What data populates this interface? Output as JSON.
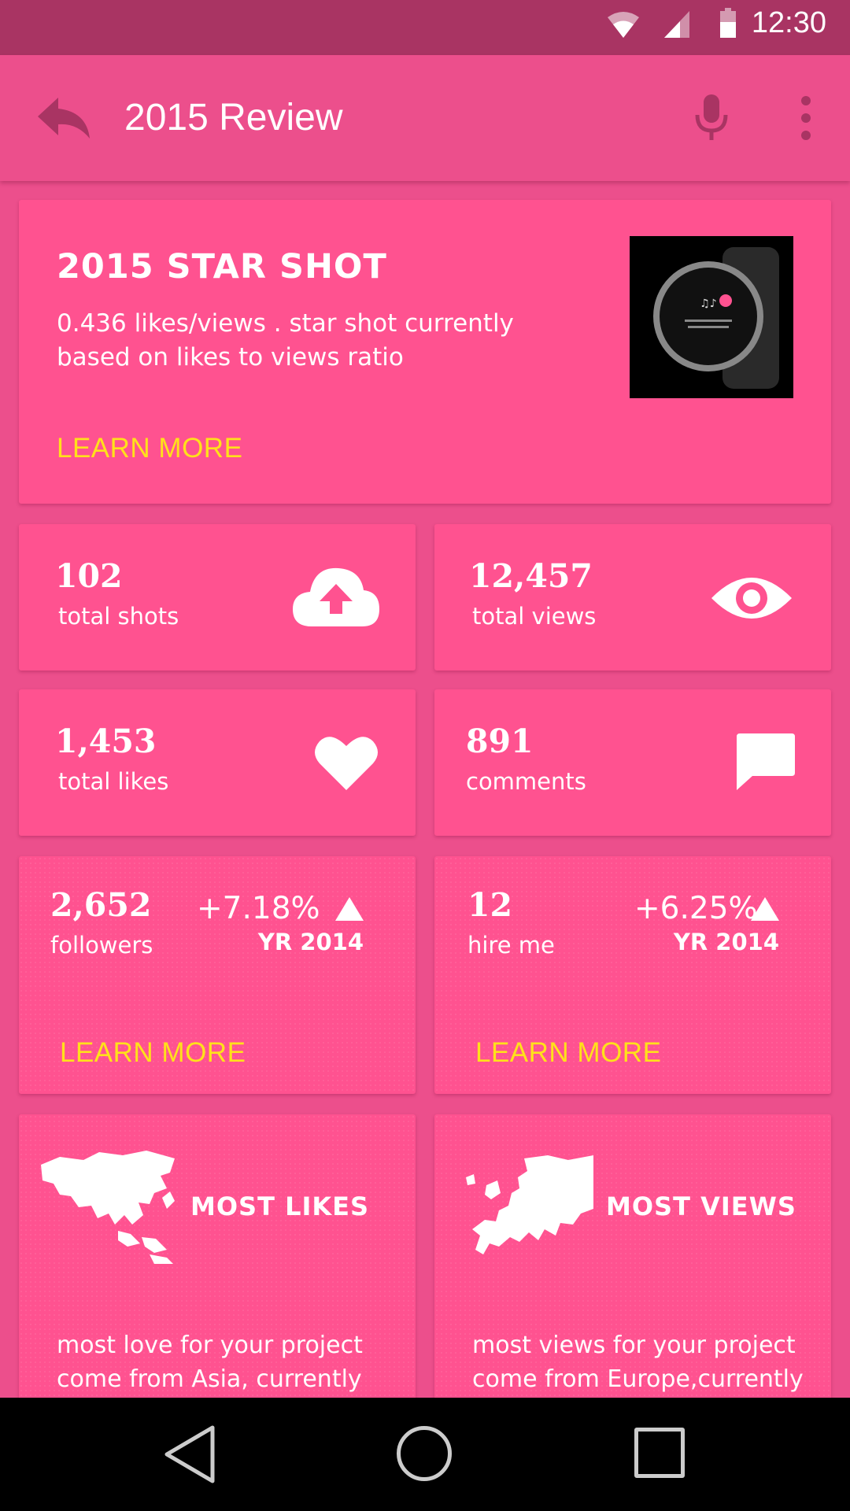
{
  "status_bar": {
    "time": "12:30"
  },
  "app_bar": {
    "title": "2015 Review"
  },
  "star_shot": {
    "title": "2015 STAR SHOT",
    "description": "0.436 likes/views . star shot currently based on likes to views ratio",
    "learn_more": "LEARN MORE"
  },
  "stats": [
    {
      "value": "102",
      "label": "total shots",
      "icon": "cloud-upload-icon"
    },
    {
      "value": "12,457",
      "label": "total views",
      "icon": "eye-icon"
    },
    {
      "value": "1,453",
      "label": "total likes",
      "icon": "heart-icon"
    },
    {
      "value": "891",
      "label": "comments",
      "icon": "comment-icon"
    }
  ],
  "growth": [
    {
      "value": "2,652",
      "label": "followers",
      "change": "+7.18%",
      "period": "YR 2014",
      "learn_more": "LEARN MORE"
    },
    {
      "value": "12",
      "label": "hire me",
      "change": "+6.25%",
      "period": "YR 2014",
      "learn_more": "LEARN MORE"
    }
  ],
  "regions": [
    {
      "title": "MOST LIKES",
      "text": "most love for your project come from Asia, currently",
      "icon": "asia-map-icon"
    },
    {
      "title": "MOST VIEWS",
      "text": "most views for your project come from Europe,currently",
      "icon": "europe-map-icon"
    }
  ],
  "colors": {
    "status_bar": "#a93463",
    "app_bar": "#ec4f8c",
    "card": "#ff5290",
    "accent": "#ffe11a"
  }
}
